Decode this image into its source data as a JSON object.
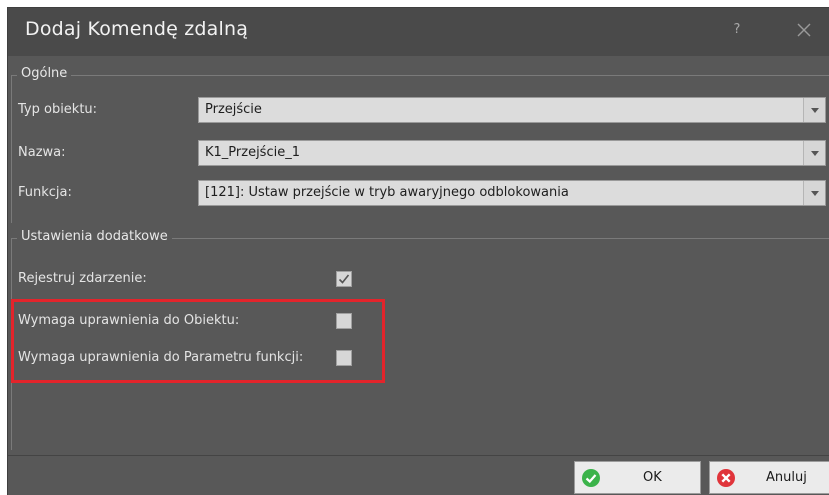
{
  "dialog": {
    "title": "Dodaj Komendę zdalną",
    "help_label": "?",
    "close_icon": "close-icon"
  },
  "general": {
    "group_title": "Ogólne",
    "fields": [
      {
        "label": "Typ obiektu:",
        "value": "Przejście"
      },
      {
        "label": "Nazwa:",
        "value": "K1_Przejście_1"
      },
      {
        "label": "Funkcja:",
        "value": "[121]: Ustaw przejście w tryb awaryjnego odblokowania"
      }
    ]
  },
  "additional": {
    "group_title": "Ustawienia dodatkowe",
    "options": [
      {
        "label": "Rejestruj zdarzenie:",
        "checked": true
      },
      {
        "label": "Wymaga uprawnienia do Obiektu:",
        "checked": false
      },
      {
        "label": "Wymaga uprawnienia do Parametru funkcji:",
        "checked": false
      }
    ]
  },
  "buttons": {
    "ok_label": "OK",
    "cancel_label": "Anuluj"
  },
  "colors": {
    "background": "#585858",
    "highlight": "#e3242b",
    "ok_icon": "#3bb34a",
    "cancel_icon": "#e0343a"
  }
}
